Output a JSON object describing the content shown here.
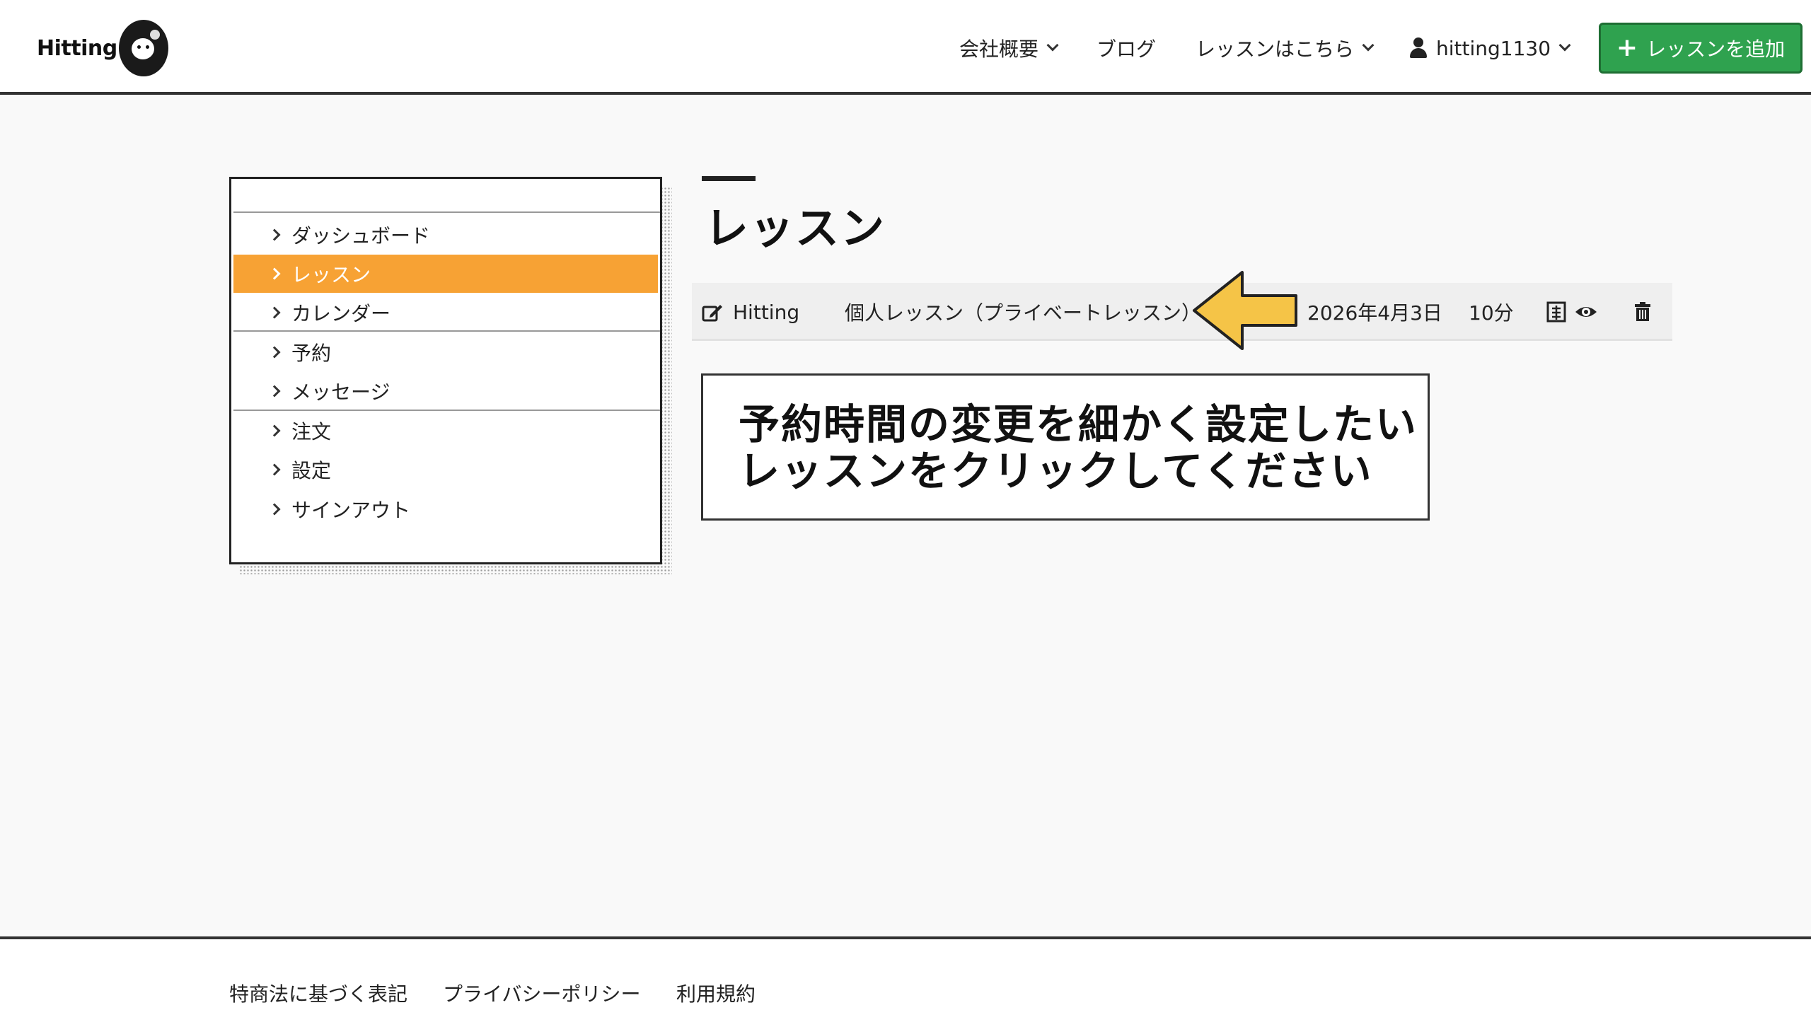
{
  "brand": {
    "logo_text": "Hitting"
  },
  "nav": {
    "items": [
      {
        "label": "会社概要",
        "has_dropdown": true
      },
      {
        "label": "ブログ",
        "has_dropdown": false
      },
      {
        "label": "レッスンはこちら",
        "has_dropdown": true
      }
    ],
    "user": {
      "label": "hitting1130",
      "icon": "user-icon",
      "has_dropdown": true
    },
    "add_button": {
      "label": "レッスンを追加",
      "icon": "plus-icon",
      "color": "#2fa24f"
    }
  },
  "sidebar": {
    "items": [
      {
        "label": "ダッシュボード",
        "active": false
      },
      {
        "label": "レッスン",
        "active": true
      },
      {
        "label": "カレンダー",
        "active": false
      },
      {
        "label": "予約",
        "active": false
      },
      {
        "label": "メッセージ",
        "active": false
      },
      {
        "label": "注文",
        "active": false
      },
      {
        "label": "設定",
        "active": false
      },
      {
        "label": "サインアウト",
        "active": false
      }
    ],
    "active_color": "#f7a234"
  },
  "main": {
    "title": "レッスン",
    "lesson_row": {
      "name": "Hitting",
      "type": "個人レッスン（プライベートレッスン）",
      "date": "2026年4月3日",
      "duration": "10分",
      "actions": [
        "copy-icon",
        "eye-icon",
        "trash-icon"
      ]
    },
    "callout": {
      "line1": "予約時間の変更を細かく設定したい",
      "line2": "レッスンをクリックしてください"
    },
    "arrow_color": "#f5c447"
  },
  "footer": {
    "links": [
      "特商法に基づく表記",
      "プライバシーポリシー",
      "利用規約"
    ]
  }
}
